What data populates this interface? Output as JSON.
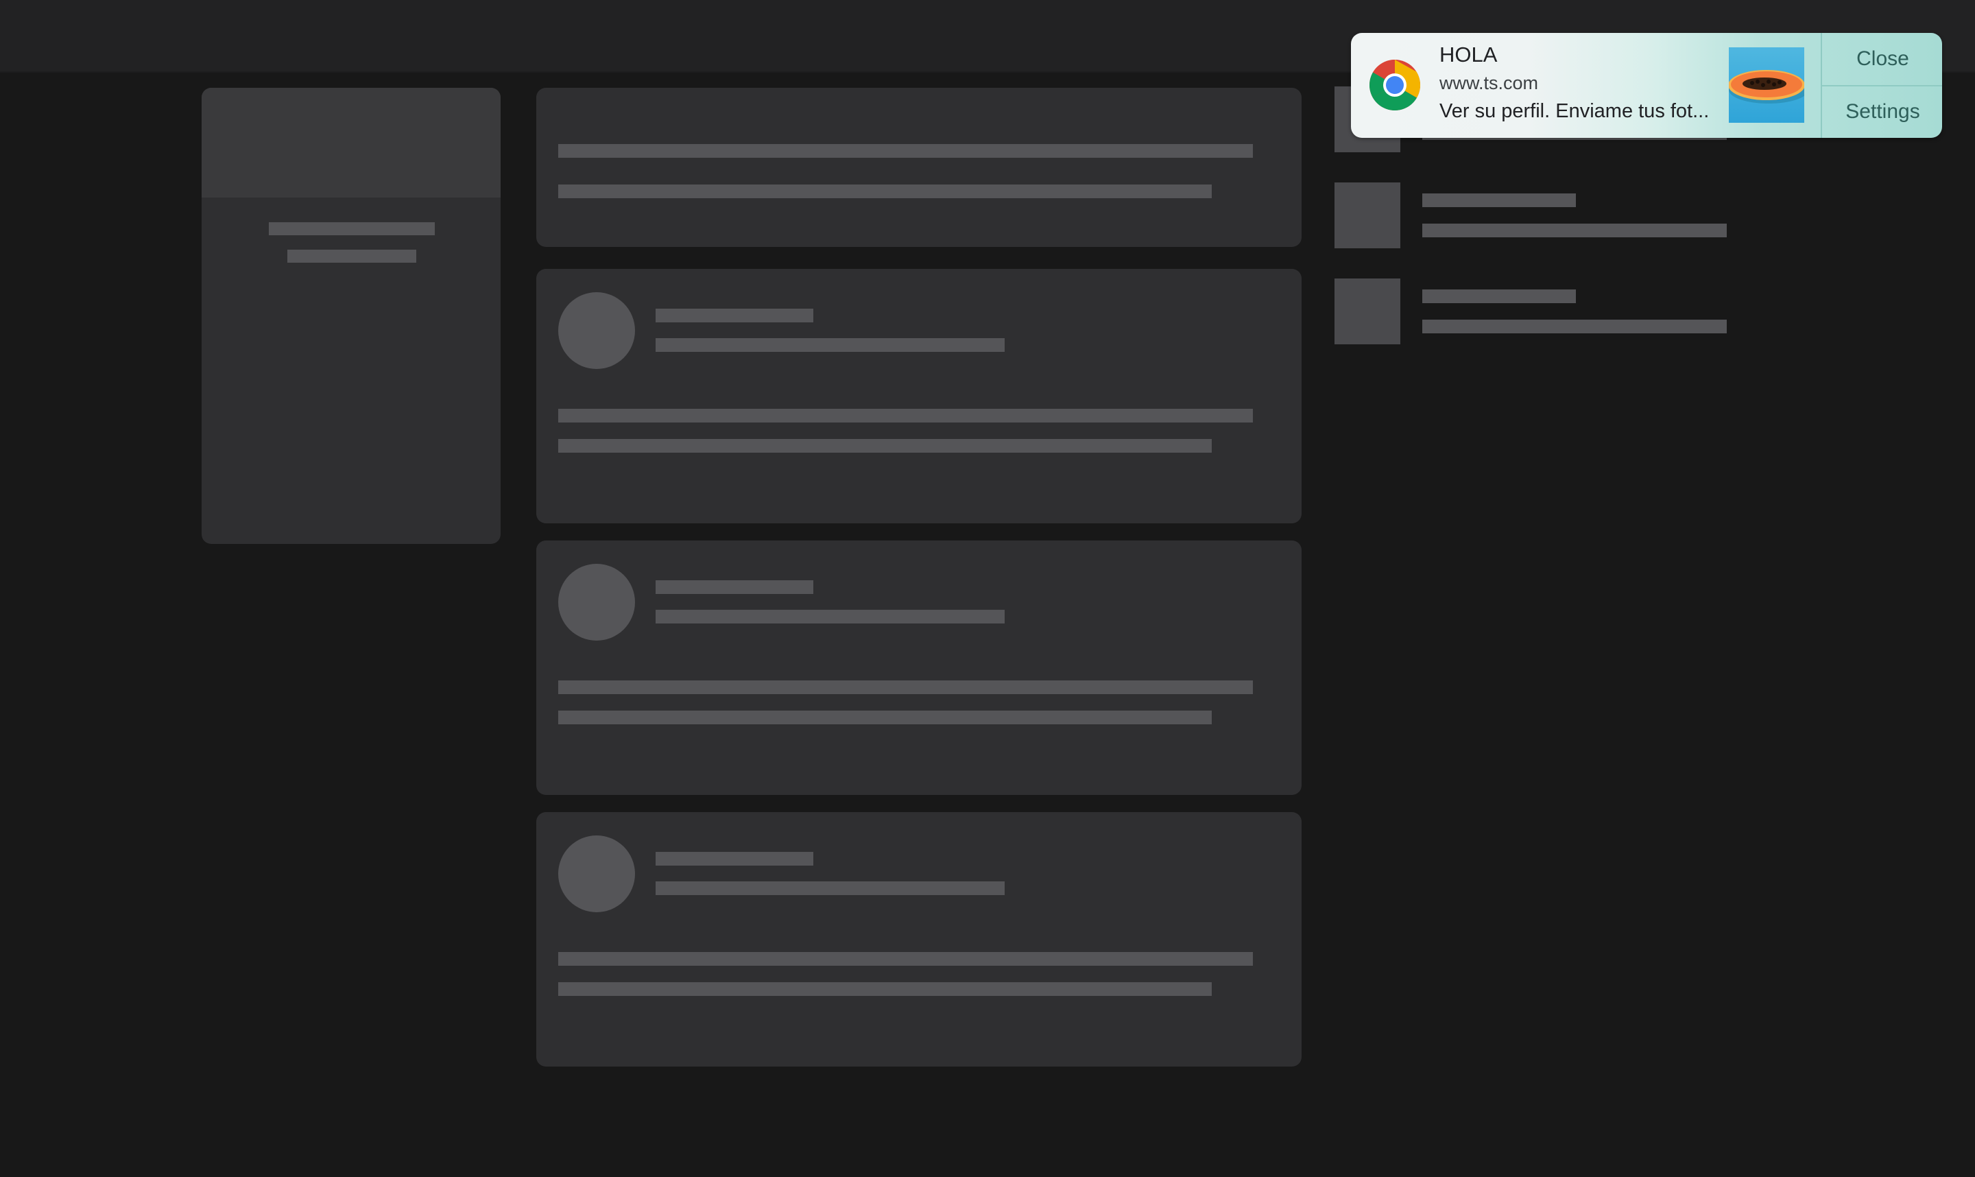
{
  "notification": {
    "title": "HOLA",
    "origin": "www.ts.com",
    "body": "Ver su perfil. Enviame tus fot...",
    "app_icon": "chrome-icon",
    "image": "papaya-image",
    "actions": {
      "close_label": "Close",
      "settings_label": "Settings"
    }
  },
  "colors": {
    "background": "#181818",
    "topbar": "#222223",
    "card": "#2f2f31",
    "skeleton": "#555558",
    "notification_accent": "#a6dbd4"
  }
}
